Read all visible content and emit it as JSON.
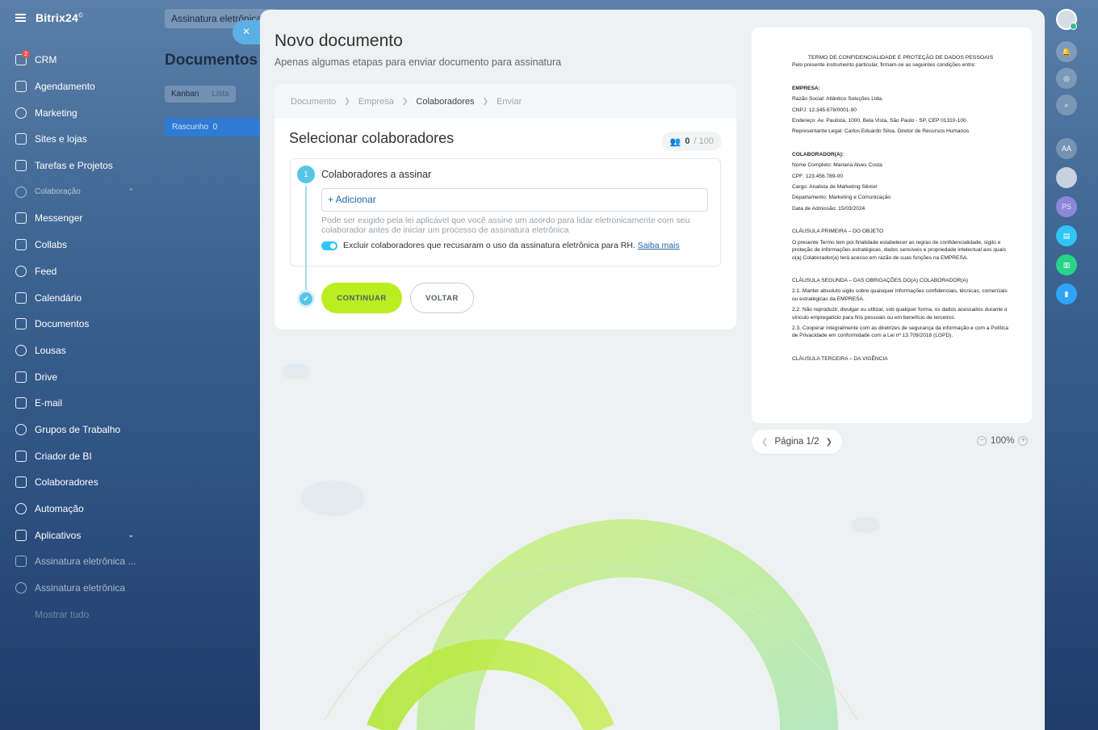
{
  "sidebar": {
    "logo": "Bitrix24",
    "logo_mark": "©",
    "crm_badge": "2",
    "items": [
      {
        "label": "CRM",
        "icon": "filter-icon"
      },
      {
        "label": "Agendamento",
        "icon": "calendar-check-icon"
      },
      {
        "label": "Marketing",
        "icon": "target-icon"
      },
      {
        "label": "Sites e lojas",
        "icon": "cart-icon"
      },
      {
        "label": "Tarefas e Projetos",
        "icon": "checkbox-icon"
      },
      {
        "label": "Colaboração",
        "icon": "collab-icon"
      },
      {
        "label": "Messenger",
        "icon": "chat-icon"
      },
      {
        "label": "Collabs",
        "icon": "collabs-icon"
      },
      {
        "label": "Feed",
        "icon": "feed-icon"
      },
      {
        "label": "Calendário",
        "icon": "calendar-icon"
      },
      {
        "label": "Documentos",
        "icon": "document-icon"
      },
      {
        "label": "Lousas",
        "icon": "board-icon"
      },
      {
        "label": "Drive",
        "icon": "drive-icon"
      },
      {
        "label": "E-mail",
        "icon": "mail-icon"
      },
      {
        "label": "Grupos de Trabalho",
        "icon": "group-icon"
      },
      {
        "label": "Criador de BI",
        "icon": "chart-icon"
      },
      {
        "label": "Colaboradores",
        "icon": "employees-icon"
      },
      {
        "label": "Automação",
        "icon": "automation-icon"
      },
      {
        "label": "Aplicativos",
        "icon": "apps-icon"
      },
      {
        "label": "Assinatura eletrônica ...",
        "icon": "signature-icon"
      },
      {
        "label": "Assinatura eletrônica",
        "icon": "signature-icon"
      },
      {
        "label": "Mostrar tudo",
        "icon": ""
      }
    ]
  },
  "background": {
    "top_field": "Assinatura eletrônica",
    "title": "Documentos d",
    "tabs": [
      "Kanban",
      "Lista"
    ],
    "column": "Rascunho",
    "column_count": "0"
  },
  "modal": {
    "close": "×",
    "title": "Novo documento",
    "subtitle": "Apenas algumas etapas para enviar documento para assinatura",
    "breadcrumbs": [
      "Documento",
      "Empresa",
      "Colaboradores",
      "Enviar"
    ],
    "section_title": "Selecionar colaboradores",
    "counter_value": "0",
    "counter_max": "/ 100",
    "step_number": "1",
    "step_label": "Colaboradores a assinar",
    "add_label": "+ Adicionar",
    "hint": "Pode ser exigido pela lei aplicável que você assine um acordo para lidar eletronicamente com seu colaborador antes de iniciar um processo de assinatura eletrônica",
    "toggle_text": "Excluir colaboradores que recusaram o uso da assinatura eletrônica para RH.",
    "toggle_link": "Saiba mais",
    "continue_label": "CONTINUAR",
    "back_label": "VOLTAR"
  },
  "preview": {
    "title": "TERMO DE CONFIDENCIALIDADE E PROTEÇÃO DE DADOS PESSOAIS",
    "intro": "Pelo presente instrumento particular, firmam-se as seguintes condições entre:",
    "empresa_h": "EMPRESA:",
    "empresa_razao": "Razão Social: Atlântico Soluções Ltda.",
    "empresa_cnpj": "CNPJ: 12.345.678/0001-90",
    "empresa_end": "Endereço: Av. Paulista, 1000, Bela Vista, São Paulo - SP, CEP 01310-100",
    "empresa_rep": "Representante Legal: Carlos Eduardo Silva, Diretor de Recursos Humanos",
    "colab_h": "COLABORADOR(A):",
    "colab_nome": "Nome Completo: Mariana Alves Costa",
    "colab_cpf": "CPF: 123.456.789-00",
    "colab_cargo": "Cargo: Analista de Marketing Sênior",
    "colab_dep": "Departamento: Marketing e Comunicação",
    "colab_adm": "Data de Admissão: 15/03/2024",
    "c1_h": "CLÁUSULA PRIMEIRA – DO OBJETO",
    "c1_t": "O presente Termo tem por finalidade estabelecer as regras de confidencialidade, sigilo e proteção de informações estratégicas, dados sensíveis e propriedade intelectual aos quais o(a) Colaborador(a) terá acesso em razão de suas funções na EMPRESA.",
    "c2_h": "CLÁUSULA SEGUNDA – DAS OBRIGAÇÕES DO(A) COLABORADOR(A)",
    "c2_1": "2.1. Manter absoluto sigilo sobre quaisquer informações confidenciais, técnicas, comerciais ou estratégicas da EMPRESA.",
    "c2_2": "2.2. Não reproduzir, divulgar ou utilizar, sob qualquer forma, os dados acessados durante o vínculo empregatício para fins pessoais ou em benefício de terceiros.",
    "c2_3": "2.3. Cooperar integralmente com as diretrizes de segurança da informação e com a Política de Privacidade em conformidade com a Lei nº 13.709/2018 (LGPD).",
    "c3_h": "CLÁUSULA TERCEIRA – DA VIGÊNCIA",
    "page": "Página 1/2",
    "zoom": "100%"
  },
  "rail": {
    "initials_1": "AA",
    "initials_2": "PS"
  }
}
